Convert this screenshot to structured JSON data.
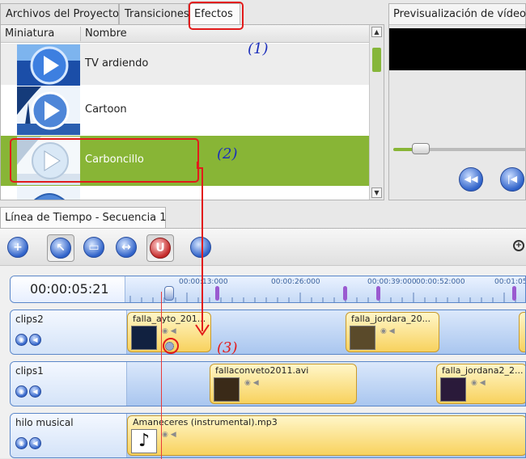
{
  "tabs": [
    "Archivos del Proyecto",
    "Transiciones",
    "Efectos"
  ],
  "effects_list": {
    "columns": [
      "Miniatura",
      "Nombre"
    ],
    "items": [
      {
        "name": "TV ardiendo",
        "thumb_icon": "play-thumbnail-icon"
      },
      {
        "name": "Cartoon",
        "thumb_icon": "play-thumbnail-icon"
      },
      {
        "name": "Carboncillo",
        "thumb_icon": "play-thumbnail-icon"
      }
    ],
    "selected": "Carboncillo"
  },
  "preview": {
    "title": "Previsualización de vídeo",
    "buttons": [
      "rewind-icon",
      "previous-frame-icon"
    ]
  },
  "annotations": [
    "(1)",
    "(2)",
    "(3)"
  ],
  "timeline": {
    "tab_label": "Línea de Tiempo - Secuencia 1",
    "toolbar_icons": [
      "add-track-icon",
      "select-pointer-icon",
      "razor-icon",
      "resize-icon",
      "snap-magnet-icon",
      "timeline-globe-icon",
      "zoom-in-icon"
    ],
    "timecode": "00:00:05:21",
    "ruler_labels": [
      "00:00:13:000",
      "00:00:26:000",
      "00:00:39:000",
      "00:00:52:000",
      "00:01:05"
    ],
    "tracks": [
      {
        "name": "clips2",
        "clips": [
          "falla_ayto_201...",
          "falla_jordara_20..."
        ]
      },
      {
        "name": "clips1",
        "clips": [
          "fallaconveto2011.avi",
          "falla_jordana2_2..."
        ]
      },
      {
        "name": "hilo musical",
        "clips": [
          "Amaneceres (instrumental).mp3"
        ]
      }
    ]
  },
  "colors": {
    "selection": "#88b536",
    "annotation_red": "#e21b1b",
    "annotation_blue": "#1a2dbb",
    "clip_fill": "#f8d25e",
    "track_blue": "#a9c6ef"
  }
}
